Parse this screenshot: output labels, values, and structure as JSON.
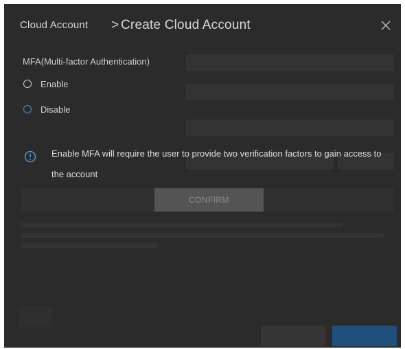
{
  "header": {
    "breadcrumb": "Cloud Account",
    "separator": ">",
    "title": "Create Cloud Account"
  },
  "mfa": {
    "label": "MFA(Multi-factor Authentication)",
    "options": [
      {
        "label": "Enable",
        "selected": false
      },
      {
        "label": "Disable",
        "selected": true
      }
    ],
    "info_text": "Enable MFA will require the user to provide two verification factors to gain access to the account"
  },
  "actions": {
    "confirm_label": "CONFIRM"
  },
  "colors": {
    "dialog_bg": "#2b2b2b",
    "accent": "#4a90d9",
    "confirm_bg": "#545454"
  }
}
